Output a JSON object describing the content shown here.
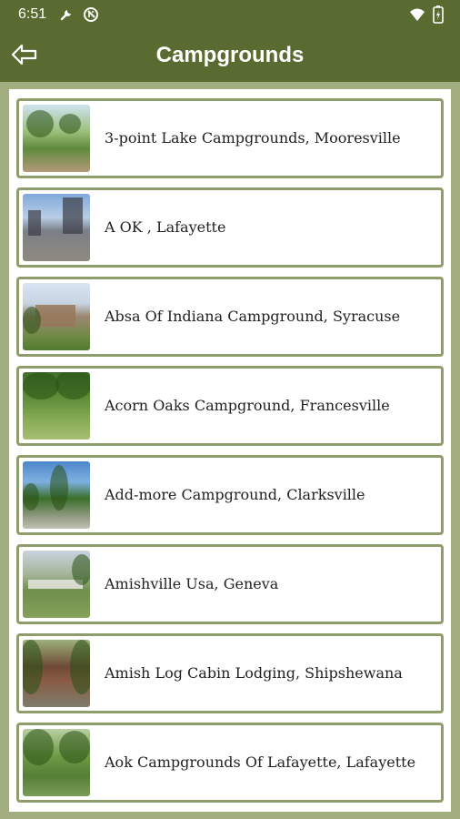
{
  "status_bar": {
    "time": "6:51",
    "icons": [
      "wrench-icon",
      "no-sim-icon",
      "wifi-icon",
      "battery-icon"
    ]
  },
  "app_bar": {
    "title": "Campgrounds",
    "back_icon": "arrow-back-icon"
  },
  "colors": {
    "bar_green": "#5a6b31",
    "background_green": "#a2ae80",
    "item_border": "#8f9c6b"
  },
  "campgrounds": [
    {
      "name": "3-point Lake Campgrounds, Mooresville"
    },
    {
      "name": "A OK , Lafayette"
    },
    {
      "name": "Absa Of Indiana Campground, Syracuse"
    },
    {
      "name": "Acorn Oaks Campground, Francesville"
    },
    {
      "name": "Add-more Campground, Clarksville"
    },
    {
      "name": "Amishville Usa, Geneva"
    },
    {
      "name": "Amish Log Cabin Lodging, Shipshewana"
    },
    {
      "name": "Aok Campgrounds Of Lafayette, Lafayette"
    }
  ]
}
